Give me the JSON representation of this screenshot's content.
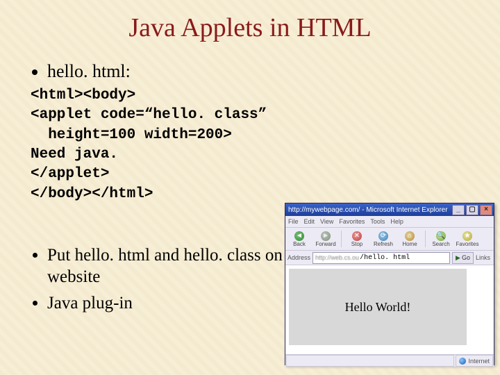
{
  "slide": {
    "title": "Java Applets in HTML",
    "bullet1": "hello. html:",
    "code_line1": "<html><body>",
    "code_line2": "<applet code=“hello. class”",
    "code_line3": "  height=100 width=200>",
    "code_line4": "Need java.",
    "code_line5": "</applet>",
    "code_line6": "</body></html>",
    "bullet2": "Put hello. html and hello. class on website",
    "bullet3": "Java plug-in"
  },
  "browser": {
    "title": "http://mywebpage.com/ - Microsoft Internet Explorer",
    "menu": {
      "file": "File",
      "edit": "Edit",
      "view": "View",
      "favorites": "Favorites",
      "tools": "Tools",
      "help": "Help"
    },
    "toolbar": {
      "back": "Back",
      "forward": "Forward",
      "stop": "Stop",
      "refresh": "Refresh",
      "home": "Home",
      "search": "Search",
      "favorites": "Favorites"
    },
    "address_label": "Address",
    "address_prefix": "http://web.cs.ou",
    "address_suffix": "/hello. html",
    "go": "Go",
    "links": "Links",
    "applet_text": "Hello World!",
    "status": "Internet"
  }
}
